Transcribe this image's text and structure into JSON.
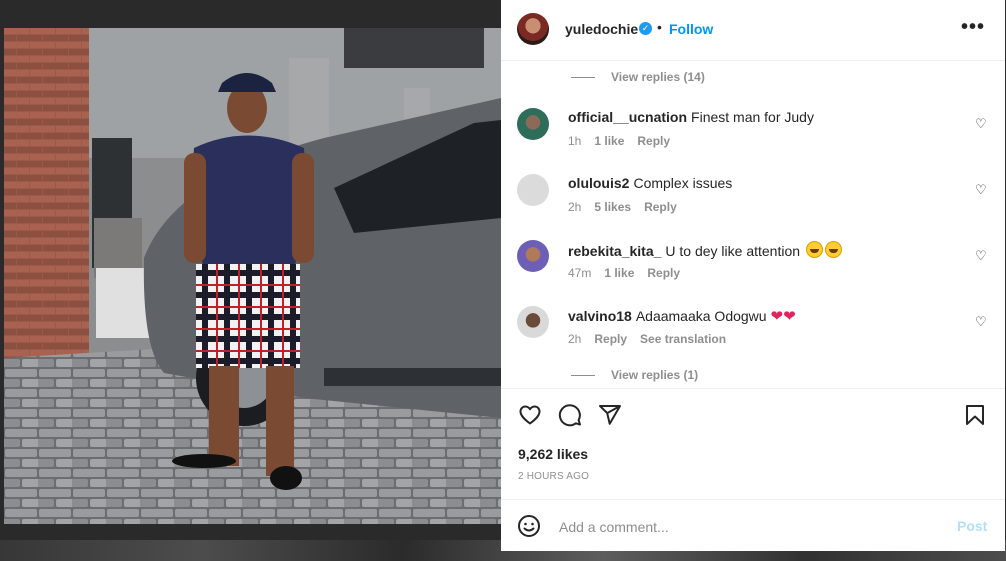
{
  "post": {
    "username": "yuledochie",
    "verified_icon": "verified-badge-icon",
    "separator": "•",
    "follow_label": "Follow",
    "more_icon": "more-options-icon",
    "more_label": "•••"
  },
  "comments": {
    "view_replies_top": "View replies (14)",
    "items": [
      {
        "user": "official__ucnation",
        "text": "Finest man for Judy",
        "time": "1h",
        "likes": "1 like",
        "reply": "Reply",
        "extra": ""
      },
      {
        "user": "olulouis2",
        "text": "Complex issues",
        "time": "2h",
        "likes": "5 likes",
        "reply": "Reply",
        "extra": ""
      },
      {
        "user": "rebekita_kita_",
        "text": "U to dey like attention",
        "time": "47m",
        "likes": "1 like",
        "reply": "Reply",
        "extra": ""
      },
      {
        "user": "valvino18",
        "text": "Adaamaaka Odogwu",
        "time": "2h",
        "likes": "",
        "reply": "Reply",
        "extra": "See translation"
      }
    ],
    "view_replies_bottom": "View replies (1)",
    "heart_glyph": "♡",
    "emoji_heart": "❤"
  },
  "actions": {
    "like_icon": "heart-icon",
    "comment_icon": "comment-icon",
    "share_icon": "share-icon",
    "save_icon": "bookmark-icon",
    "likes": "9,262 likes",
    "time_ago": "2 HOURS AGO"
  },
  "composer": {
    "emoji_icon": "emoji-icon",
    "placeholder": "Add a comment...",
    "post_label": "Post",
    "post_color": "#b2dffc"
  },
  "colors": {
    "link_blue": "#0095f6",
    "secondary_text": "#8e8e8e",
    "verified_blue": "#1d9bf0"
  }
}
